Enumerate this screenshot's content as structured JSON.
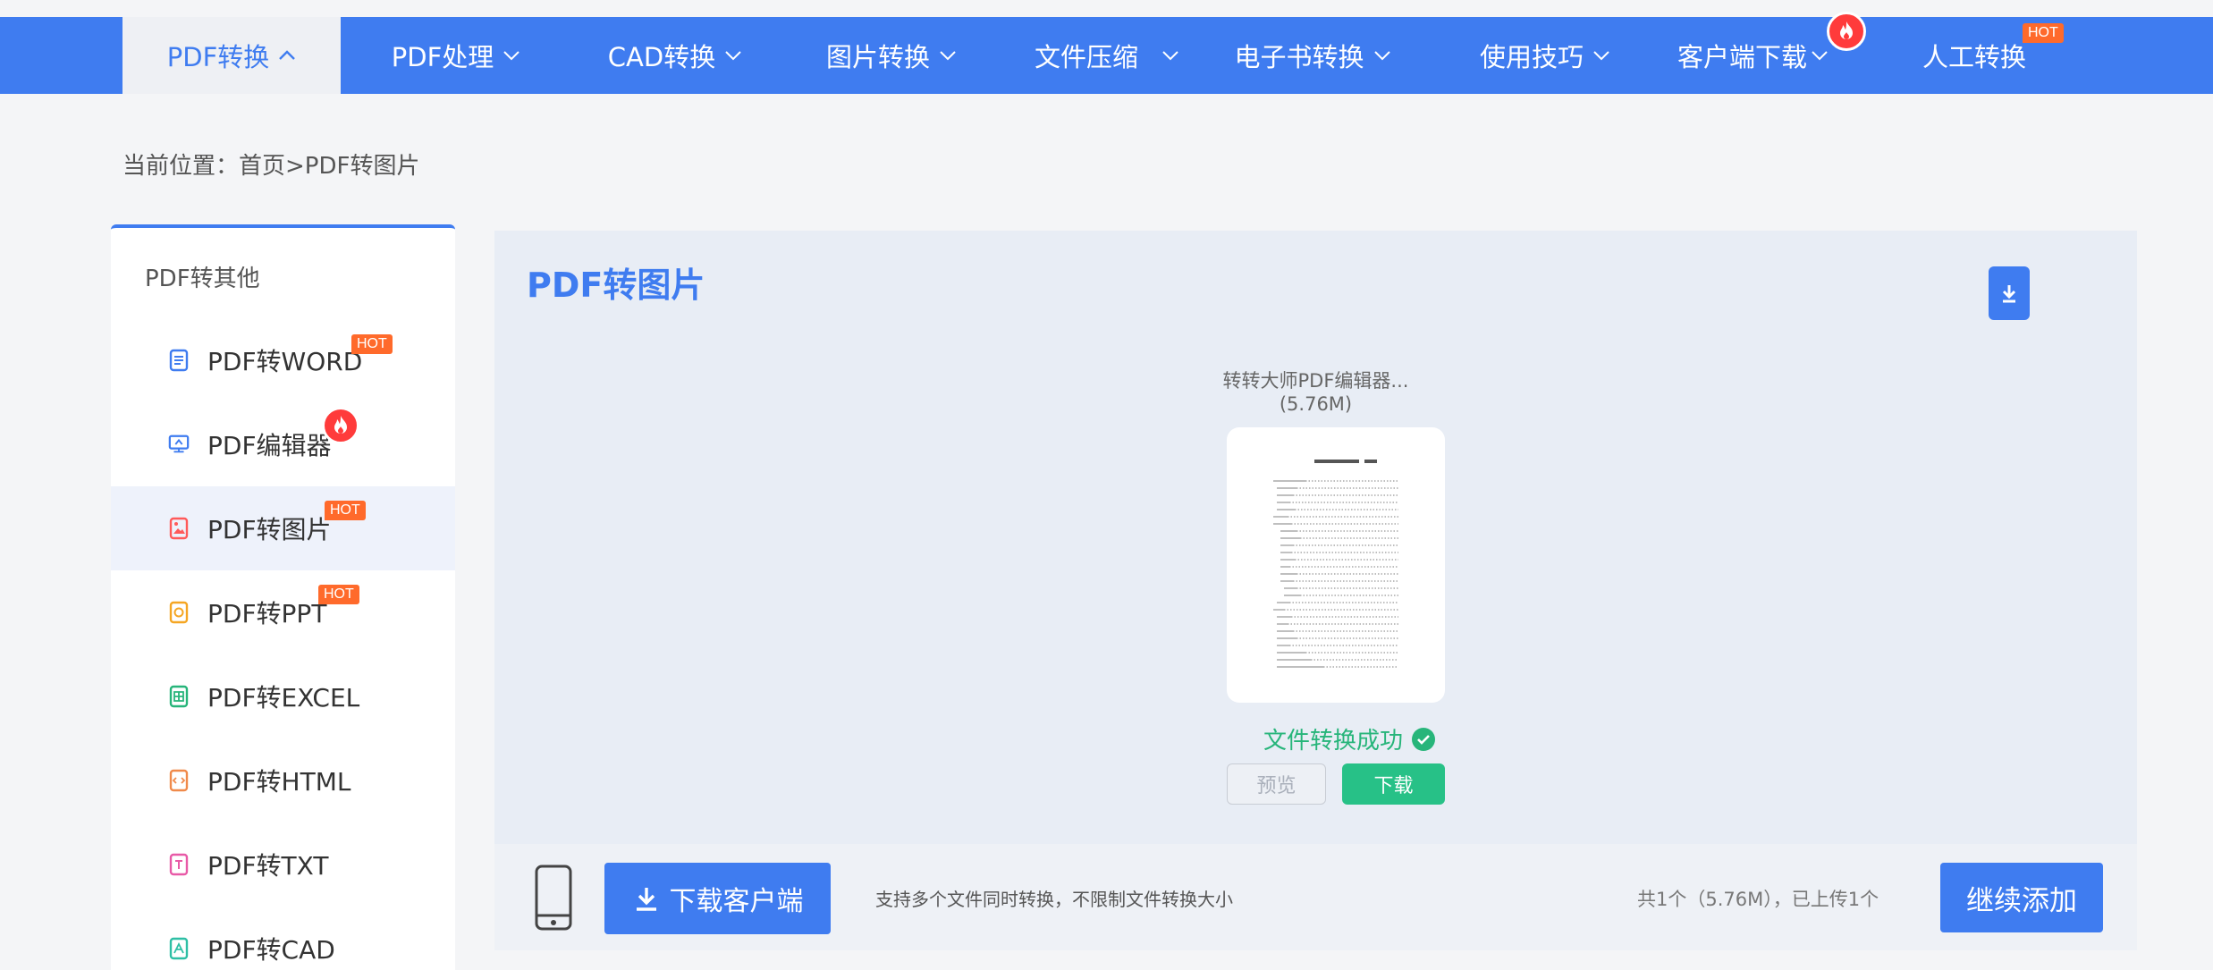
{
  "nav": {
    "items": [
      {
        "label": "PDF转换",
        "chevron": "up"
      },
      {
        "label": "PDF处理",
        "chevron": "down"
      },
      {
        "label": "CAD转换",
        "chevron": "down"
      },
      {
        "label": "图片转换",
        "chevron": "down"
      },
      {
        "label": "文件压缩",
        "chevron": "down"
      },
      {
        "label": "电子书转换",
        "chevron": "down"
      },
      {
        "label": "使用技巧",
        "chevron": "down"
      },
      {
        "label": "客户端下载",
        "chevron": "down",
        "badge": "fire-icon"
      },
      {
        "label": "人工转换",
        "badge_text": "HOT"
      }
    ],
    "colors": {
      "bar": "#3f7cf0",
      "active_bg": "#eef0f4",
      "hot": "#ff6a2b",
      "fire": "#ff3b3b"
    }
  },
  "breadcrumb": {
    "text": "当前位置：首页>PDF转图片"
  },
  "sidebar": {
    "title": "PDF转其他",
    "items": [
      {
        "label": "PDF转WORD",
        "icon": "word-doc-icon",
        "color": "#3f7cf0",
        "badge_text": "HOT"
      },
      {
        "label": "PDF编辑器",
        "icon": "monitor-edit-icon",
        "color": "#3f7cf0",
        "badge": "fire-icon"
      },
      {
        "label": "PDF转图片",
        "icon": "image-file-icon",
        "color": "#ff5a5a",
        "badge_text": "HOT",
        "active": true
      },
      {
        "label": "PDF转PPT",
        "icon": "ppt-file-icon",
        "color": "#f5a623",
        "badge_text": "HOT"
      },
      {
        "label": "PDF转EXCEL",
        "icon": "excel-file-icon",
        "color": "#27b57a"
      },
      {
        "label": "PDF转HTML",
        "icon": "html-file-icon",
        "color": "#f08a4b"
      },
      {
        "label": "PDF转TXT",
        "icon": "txt-file-icon",
        "color": "#e85aa7"
      },
      {
        "label": "PDF转CAD",
        "icon": "cad-file-icon",
        "color": "#2ebfa5"
      }
    ]
  },
  "main": {
    "title": "PDF转图片",
    "file": {
      "name": "转转大师PDF编辑器...",
      "size": "(5.76M)"
    },
    "status": "文件转换成功",
    "buttons": {
      "preview": "预览",
      "download": "下载"
    },
    "success_color": "#27b57a"
  },
  "bottom": {
    "client_button": "下载客户端",
    "support_text": "支持多个文件同时转换，不限制文件转换大小",
    "count_text": "共1个（5.76M），已上传1个",
    "add_button": "继续添加"
  }
}
